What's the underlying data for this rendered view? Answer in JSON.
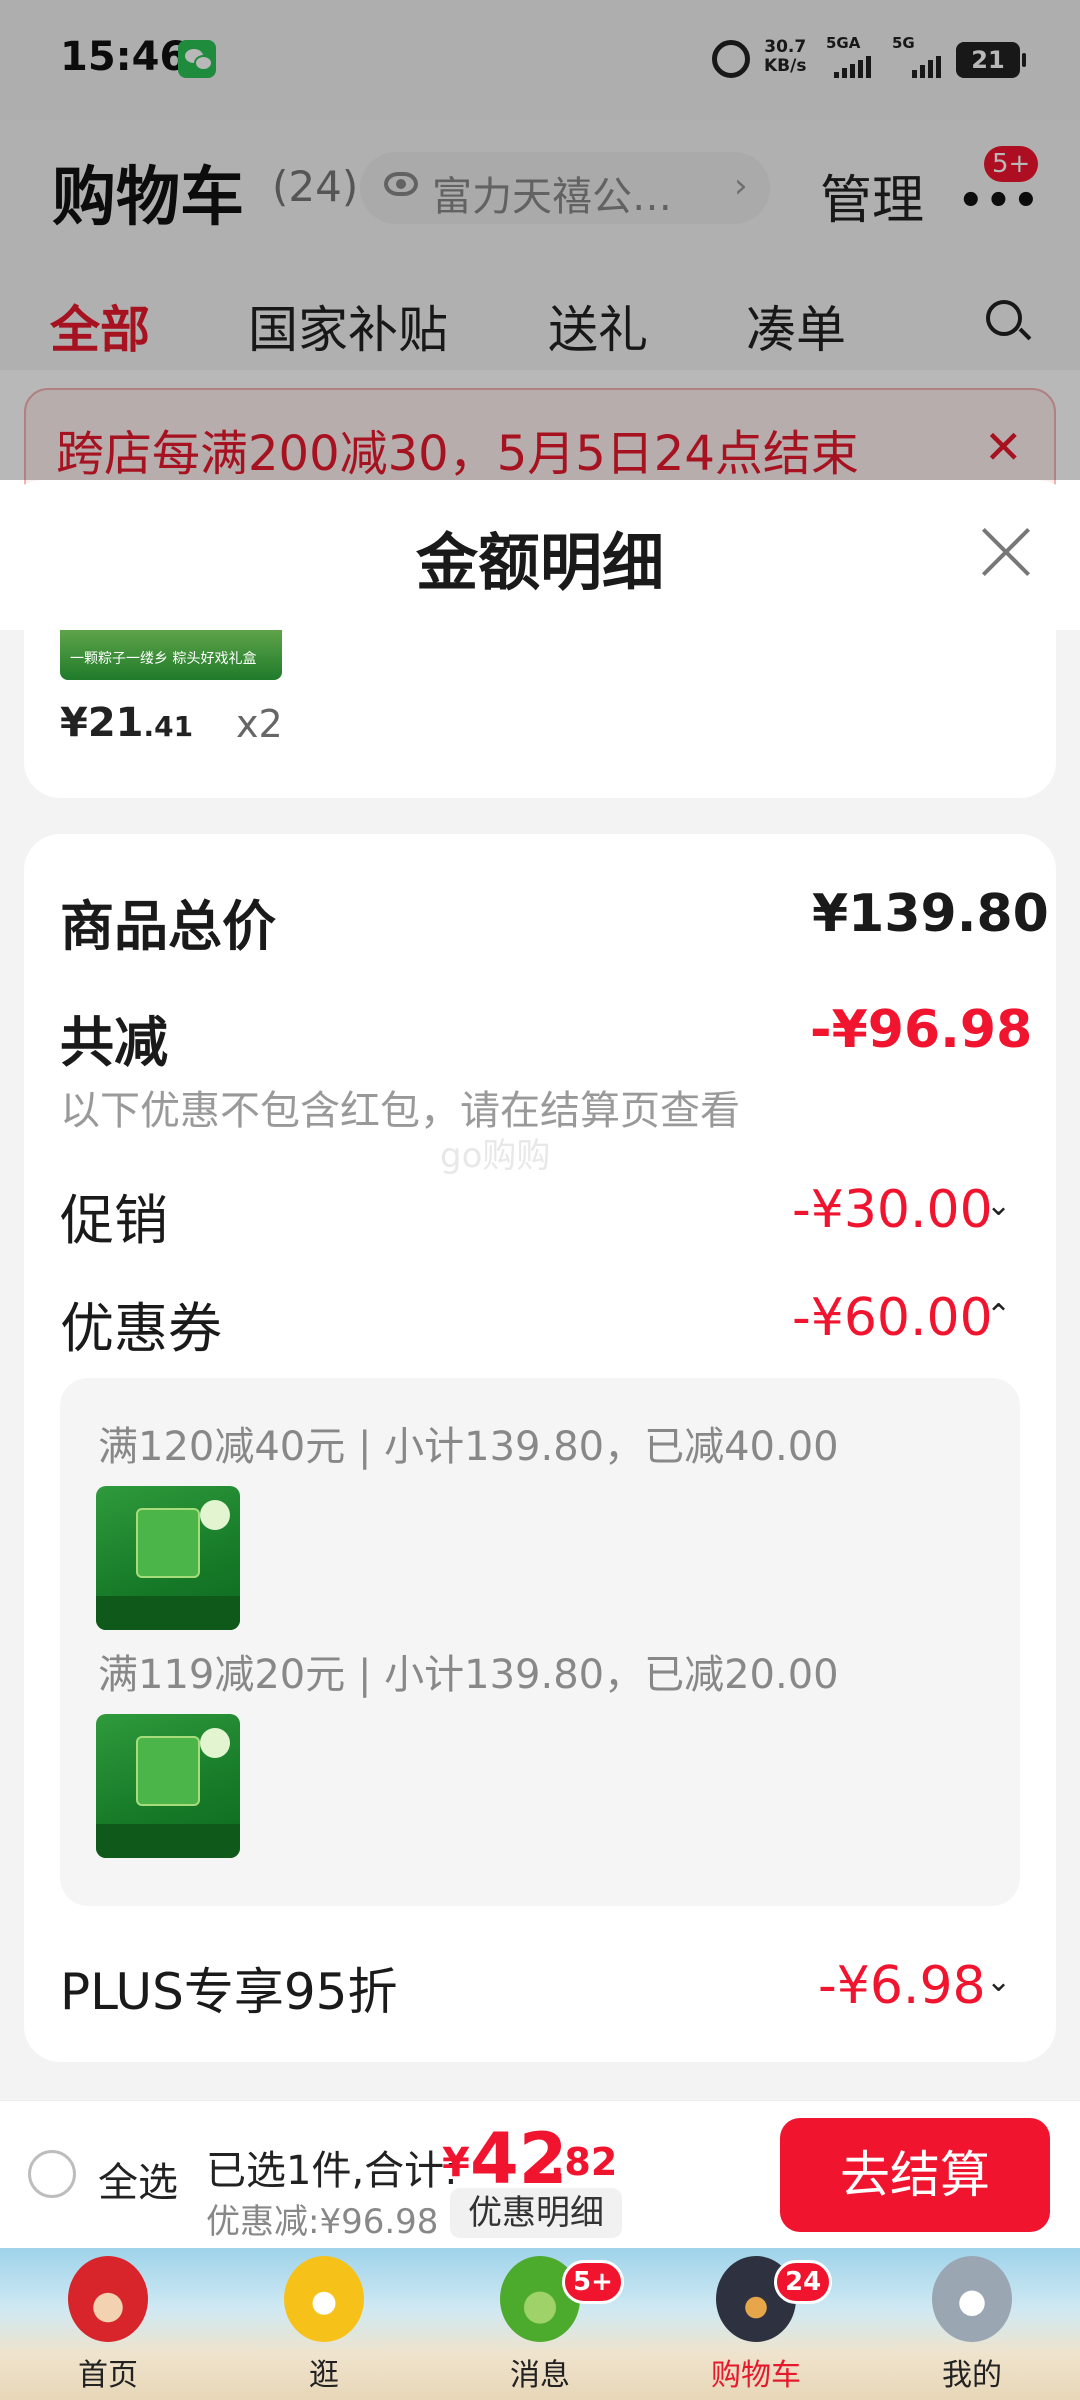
{
  "status_bar": {
    "time": "15:46",
    "net_speed_value": "30.7",
    "net_speed_unit": "KB/s",
    "sim1": "5GA",
    "sim2": "5G",
    "battery": "21"
  },
  "header": {
    "title": "购物车",
    "count": "(24)",
    "address": "富力天禧公…",
    "manage_label": "管理",
    "more_badge": "5+"
  },
  "tabs": [
    {
      "label": "全部",
      "active": true
    },
    {
      "label": "国家补贴",
      "active": false
    },
    {
      "label": "送礼",
      "active": false
    },
    {
      "label": "凑单",
      "active": false
    }
  ],
  "promo": {
    "text": "跨店每满200减30，5月5日24点结束"
  },
  "sheet": {
    "title": "金额明细",
    "product": {
      "image_caption": "一颗粽子一缕乡  粽头好戏礼盒",
      "price_int": "¥21",
      "price_dec": ".41",
      "quantity": "x2"
    },
    "total_price_label": "商品总价",
    "total_price_value": "¥139.80",
    "total_discount_label": "共减",
    "total_discount_value": "-¥96.98",
    "note": "以下优惠不包含红包，请在结算页查看",
    "watermark": "go购购",
    "promotion_label": "促销",
    "promotion_value": "-¥30.00",
    "coupon_label": "优惠券",
    "coupon_value": "-¥60.00",
    "coupons": [
      {
        "text": "满120减40元 | 小计139.80，已减40.00"
      },
      {
        "text": "满119减20元 | 小计139.80，已减20.00"
      }
    ],
    "plus_label": "PLUS专享95折",
    "plus_value": "-¥6.98"
  },
  "checkout": {
    "select_all_label": "全选",
    "selected_text": "已选1件,合计:",
    "total_currency": "¥",
    "total_int": "42",
    "total_dec": ".82",
    "discount_text": "优惠减:¥96.98",
    "detail_chip": "优惠明细",
    "checkout_button": "去结算"
  },
  "bottom_tabs": [
    {
      "label": "首页",
      "active": false,
      "badge": ""
    },
    {
      "label": "逛",
      "active": false,
      "badge": ""
    },
    {
      "label": "消息",
      "active": false,
      "badge": "5+"
    },
    {
      "label": "购物车",
      "active": true,
      "badge": "24"
    },
    {
      "label": "我的",
      "active": false,
      "badge": ""
    }
  ],
  "colors": {
    "accent_red": "#f0142e",
    "tab_active_red": "#e6192d",
    "muted_text": "#999999"
  }
}
